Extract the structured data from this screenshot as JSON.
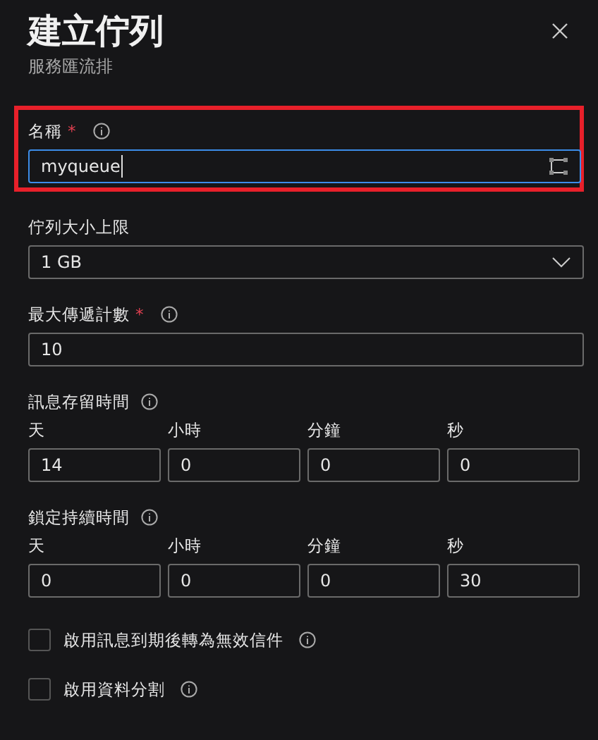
{
  "panel": {
    "title": "建立佇列",
    "subtitle": "服務匯流排"
  },
  "fields": [
    {
      "kind": "text",
      "label": "名稱",
      "required_mark": "*",
      "info": true,
      "value": "myqueue",
      "focused": true,
      "highlighted": true
    },
    {
      "kind": "select",
      "label": "佇列大小上限",
      "value": "1 GB"
    },
    {
      "kind": "text",
      "label": "最大傳遞計數",
      "required_mark": "*",
      "info": true,
      "value": "10",
      "focused": false,
      "highlighted": false
    },
    {
      "kind": "duration",
      "label": "訊息存留時間",
      "info": true,
      "parts": [
        {
          "unit": "天",
          "value": "14"
        },
        {
          "unit": "小時",
          "value": "0"
        },
        {
          "unit": "分鐘",
          "value": "0"
        },
        {
          "unit": "秒",
          "value": "0"
        }
      ]
    },
    {
      "kind": "duration",
      "label": "鎖定持續時間",
      "info": true,
      "parts": [
        {
          "unit": "天",
          "value": "0"
        },
        {
          "unit": "小時",
          "value": "0"
        },
        {
          "unit": "分鐘",
          "value": "0"
        },
        {
          "unit": "秒",
          "value": "30"
        }
      ]
    },
    {
      "kind": "checkbox",
      "label": "啟用訊息到期後轉為無效信件",
      "info": true,
      "checked": false
    },
    {
      "kind": "checkbox",
      "label": "啟用資料分割",
      "info": true,
      "checked": false
    }
  ]
}
